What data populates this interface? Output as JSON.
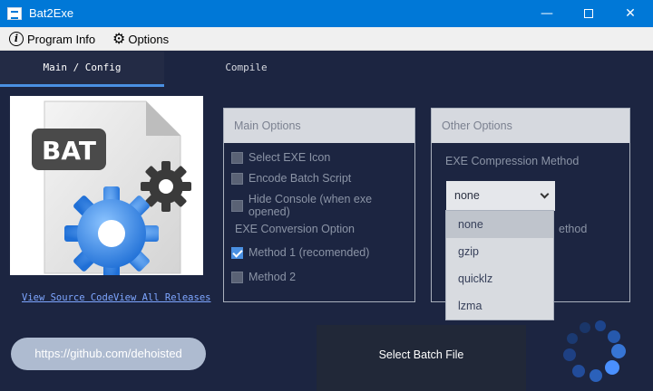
{
  "window": {
    "title": "Bat2Exe",
    "minimize": "—",
    "close": "✕"
  },
  "menu": {
    "program_info": "Program Info",
    "options": "Options"
  },
  "tabs": [
    {
      "label": "Main / Config"
    },
    {
      "label": "Compile"
    }
  ],
  "image": {
    "text": "BAT"
  },
  "links": {
    "source": "View Source Code",
    "releases": "View All Releases"
  },
  "main_options": {
    "header": "Main Options",
    "checkboxes": [
      {
        "label": "Select EXE Icon",
        "checked": false
      },
      {
        "label": "Encode Batch Script",
        "checked": false
      },
      {
        "label": "Hide Console (when exe opened)",
        "checked": false
      }
    ],
    "conversion_label": "EXE Conversion Option",
    "conversion": [
      {
        "label": "Method 1 (recomended)",
        "checked": true
      },
      {
        "label": "Method 2",
        "checked": false
      }
    ]
  },
  "other_options": {
    "header": "Other Options",
    "compression_label": "EXE Compression Method",
    "selected": "none",
    "partial_text": "ethod",
    "dropdown": [
      "none",
      "gzip",
      "quicklz",
      "lzma"
    ]
  },
  "buttons": {
    "github": "https://github.com/dehoisted",
    "select_file": "Select Batch File"
  },
  "colors": {
    "titlebar": "#0078d7",
    "background": "#1c2541",
    "accent": "#4a90e2"
  }
}
